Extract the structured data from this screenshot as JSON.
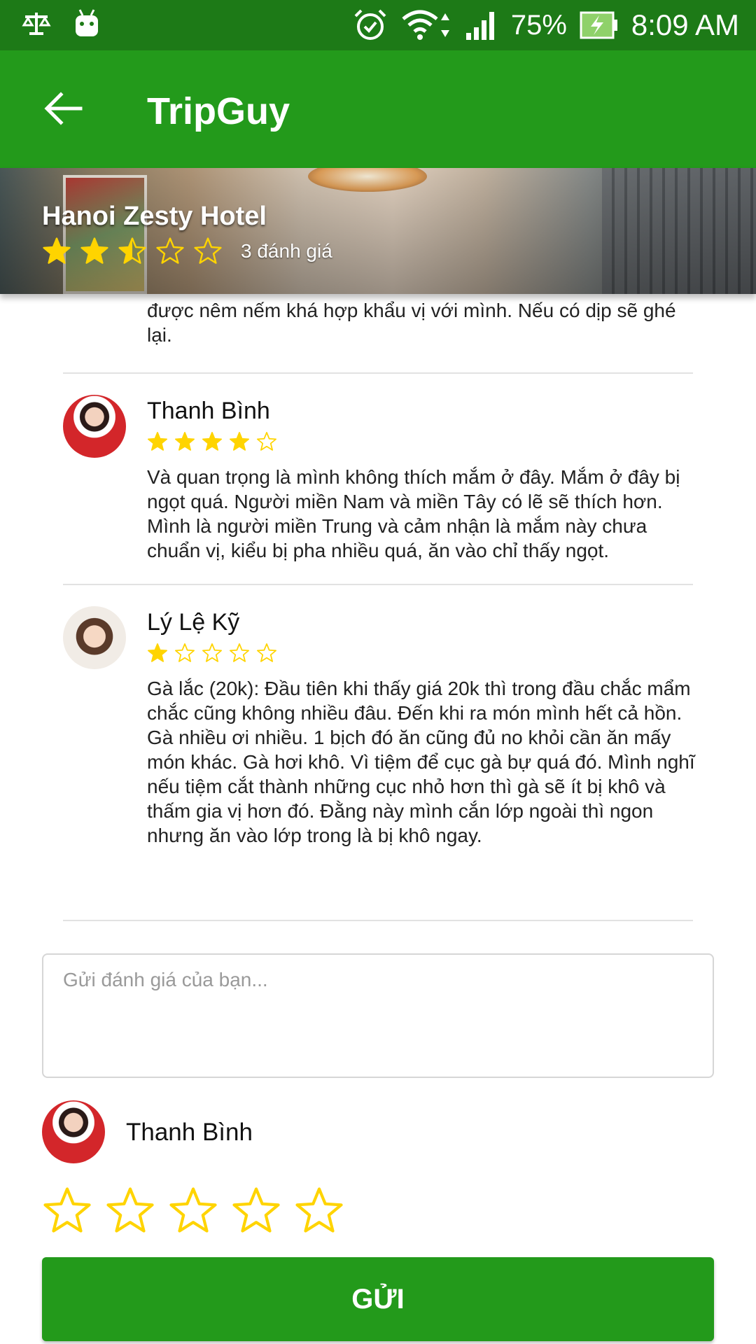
{
  "status_bar": {
    "battery": "75%",
    "time": "8:09 AM"
  },
  "app_bar": {
    "title": "TripGuy"
  },
  "hotel": {
    "name": "Hanoi Zesty Hotel",
    "rating": 2.5,
    "review_count_label": "3 đánh giá"
  },
  "reviews": {
    "partial_text": "được nêm nếm khá hợp khẩu vị với mình. Nếu có dịp sẽ ghé lại.",
    "items": [
      {
        "name": "Thanh Bình",
        "rating": 4,
        "text": " Và quan trọng là mình không thích mắm ở đây. Mắm ở đây bị ngọt quá. Người miền Nam và miền Tây có lẽ sẽ thích hơn. Mình là người miền Trung và cảm nhận là mắm này chưa chuẩn vị, kiểu bị pha nhiều quá, ăn vào chỉ thấy ngọt."
      },
      {
        "name": "Lý Lệ Kỹ",
        "rating": 1,
        "text": "Gà lắc (20k): Đầu tiên khi thấy giá 20k thì trong đầu chắc mẩm chắc cũng không nhiều đâu. Đến khi ra món mình hết cả hồn. Gà nhiều ơi nhiều. 1 bịch đó ăn cũng đủ no khỏi cần ăn mấy món khác. Gà hơi khô. Vì tiệm để cục gà bự quá đó. Mình nghĩ nếu tiệm cắt thành những cục nhỏ hơn thì gà sẽ ít bị khô và thấm gia vị hơn đó. Đằng này mình cắn lớp ngoài thì ngon nhưng ăn vào lớp trong là bị khô ngay."
      }
    ]
  },
  "compose": {
    "placeholder": "Gửi đánh giá của bạn...",
    "value": "",
    "user_name": "Thanh Bình",
    "rating": 0,
    "send_label": "GỬI"
  },
  "colors": {
    "status_bar": "#1d7a17",
    "app_bar": "#239a1b",
    "star": "#ffd400",
    "button": "#239a1b"
  }
}
